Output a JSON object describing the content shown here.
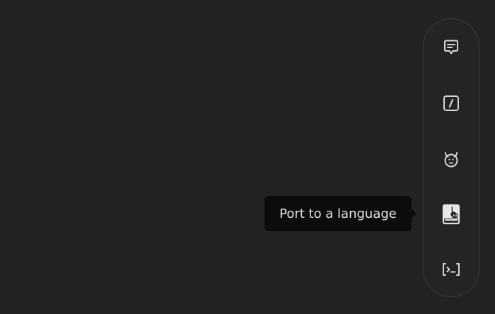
{
  "toolbar": {
    "items": [
      {
        "name": "comment-icon",
        "tooltip": ""
      },
      {
        "name": "slash-command-icon",
        "tooltip": ""
      },
      {
        "name": "bug-icon",
        "tooltip": ""
      },
      {
        "name": "book-icon",
        "tooltip": ""
      },
      {
        "name": "terminal-icon",
        "tooltip": ""
      }
    ],
    "active_tooltip": "Port to a language"
  },
  "colors": {
    "background": "#232323",
    "toolbar_border": "#3b3b3b",
    "icon": "#d6d6d6",
    "tooltip_bg": "#0c0c0c",
    "tooltip_text": "#e6e6e6"
  }
}
